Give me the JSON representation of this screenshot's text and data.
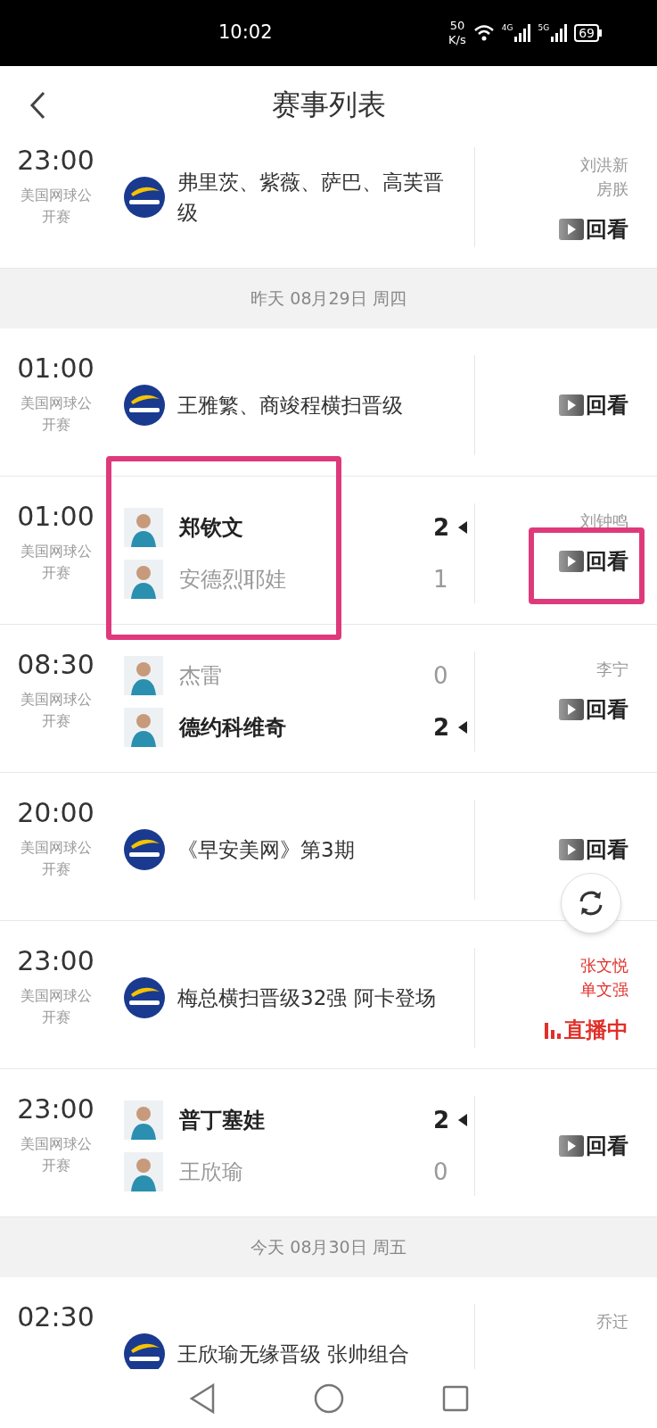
{
  "status_bar": {
    "time": "10:02",
    "net_speed": [
      "50",
      "K/s"
    ],
    "network_labels": [
      "4G",
      "5G"
    ],
    "battery": "69"
  },
  "header": {
    "title": "赛事列表"
  },
  "list": [
    {
      "kind": "event",
      "time": "23:00",
      "event": "美国网球公开赛",
      "title": "弗里茨、紫薇、萨巴、高芙晋级",
      "commentators": [
        "刘洪新",
        "房朕"
      ],
      "action": {
        "kind": "replay",
        "label": "回看"
      }
    },
    {
      "kind": "date",
      "label": "昨天 08月29日 周四"
    },
    {
      "kind": "event",
      "time": "01:00",
      "event": "美国网球公开赛",
      "title": "王雅繁、商竣程横扫晋级",
      "action": {
        "kind": "replay",
        "label": "回看"
      }
    },
    {
      "kind": "match",
      "time": "01:00",
      "event": "美国网球公开赛",
      "highlight": true,
      "players": [
        {
          "name": "郑钦文",
          "score": "2",
          "winner": true
        },
        {
          "name": "安德烈耶娃",
          "score": "1",
          "winner": false
        }
      ],
      "commentators": [
        "刘钟鸣"
      ],
      "action": {
        "kind": "replay",
        "label": "回看",
        "highlight": true
      }
    },
    {
      "kind": "match",
      "time": "08:30",
      "event": "美国网球公开赛",
      "highlight": false,
      "players": [
        {
          "name": "杰雷",
          "score": "0",
          "winner": false
        },
        {
          "name": "德约科维奇",
          "score": "2",
          "winner": true
        }
      ],
      "commentators": [
        "李宁"
      ],
      "action": {
        "kind": "replay",
        "label": "回看",
        "highlight": false
      }
    },
    {
      "kind": "event",
      "time": "20:00",
      "event": "美国网球公开赛",
      "title": "《早安美网》第3期",
      "action": {
        "kind": "replay",
        "label": "回看"
      }
    },
    {
      "kind": "event",
      "time": "23:00",
      "event": "美国网球公开赛",
      "title": "梅总横扫晋级32强 阿卡登场",
      "commentators": [
        "张文悦",
        "单文强"
      ],
      "action": {
        "kind": "live",
        "label": "直播中"
      }
    },
    {
      "kind": "match",
      "time": "23:00",
      "event": "美国网球公开赛",
      "highlight": false,
      "players": [
        {
          "name": "普丁塞娃",
          "score": "2",
          "winner": true
        },
        {
          "name": "王欣瑜",
          "score": "0",
          "winner": false
        }
      ],
      "action": {
        "kind": "replay",
        "label": "回看",
        "highlight": false
      }
    },
    {
      "kind": "date",
      "label": "今天 08月30日 周五"
    },
    {
      "kind": "event",
      "time": "02:30",
      "title": "王欣瑜无缘晋级 张帅组合",
      "commentators": [
        "乔迁"
      ]
    }
  ]
}
